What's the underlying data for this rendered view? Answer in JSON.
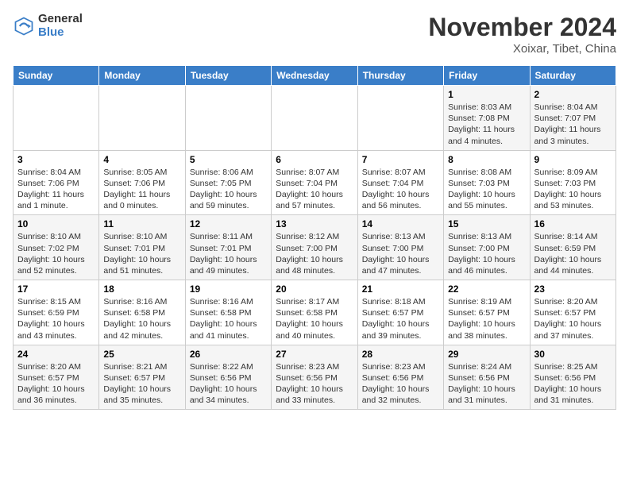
{
  "header": {
    "logo_line1": "General",
    "logo_line2": "Blue",
    "title": "November 2024",
    "subtitle": "Xoixar, Tibet, China"
  },
  "days_of_week": [
    "Sunday",
    "Monday",
    "Tuesday",
    "Wednesday",
    "Thursday",
    "Friday",
    "Saturday"
  ],
  "weeks": [
    [
      {
        "day": "",
        "info": ""
      },
      {
        "day": "",
        "info": ""
      },
      {
        "day": "",
        "info": ""
      },
      {
        "day": "",
        "info": ""
      },
      {
        "day": "",
        "info": ""
      },
      {
        "day": "1",
        "info": "Sunrise: 8:03 AM\nSunset: 7:08 PM\nDaylight: 11 hours and 4 minutes."
      },
      {
        "day": "2",
        "info": "Sunrise: 8:04 AM\nSunset: 7:07 PM\nDaylight: 11 hours and 3 minutes."
      }
    ],
    [
      {
        "day": "3",
        "info": "Sunrise: 8:04 AM\nSunset: 7:06 PM\nDaylight: 11 hours and 1 minute."
      },
      {
        "day": "4",
        "info": "Sunrise: 8:05 AM\nSunset: 7:06 PM\nDaylight: 11 hours and 0 minutes."
      },
      {
        "day": "5",
        "info": "Sunrise: 8:06 AM\nSunset: 7:05 PM\nDaylight: 10 hours and 59 minutes."
      },
      {
        "day": "6",
        "info": "Sunrise: 8:07 AM\nSunset: 7:04 PM\nDaylight: 10 hours and 57 minutes."
      },
      {
        "day": "7",
        "info": "Sunrise: 8:07 AM\nSunset: 7:04 PM\nDaylight: 10 hours and 56 minutes."
      },
      {
        "day": "8",
        "info": "Sunrise: 8:08 AM\nSunset: 7:03 PM\nDaylight: 10 hours and 55 minutes."
      },
      {
        "day": "9",
        "info": "Sunrise: 8:09 AM\nSunset: 7:03 PM\nDaylight: 10 hours and 53 minutes."
      }
    ],
    [
      {
        "day": "10",
        "info": "Sunrise: 8:10 AM\nSunset: 7:02 PM\nDaylight: 10 hours and 52 minutes."
      },
      {
        "day": "11",
        "info": "Sunrise: 8:10 AM\nSunset: 7:01 PM\nDaylight: 10 hours and 51 minutes."
      },
      {
        "day": "12",
        "info": "Sunrise: 8:11 AM\nSunset: 7:01 PM\nDaylight: 10 hours and 49 minutes."
      },
      {
        "day": "13",
        "info": "Sunrise: 8:12 AM\nSunset: 7:00 PM\nDaylight: 10 hours and 48 minutes."
      },
      {
        "day": "14",
        "info": "Sunrise: 8:13 AM\nSunset: 7:00 PM\nDaylight: 10 hours and 47 minutes."
      },
      {
        "day": "15",
        "info": "Sunrise: 8:13 AM\nSunset: 7:00 PM\nDaylight: 10 hours and 46 minutes."
      },
      {
        "day": "16",
        "info": "Sunrise: 8:14 AM\nSunset: 6:59 PM\nDaylight: 10 hours and 44 minutes."
      }
    ],
    [
      {
        "day": "17",
        "info": "Sunrise: 8:15 AM\nSunset: 6:59 PM\nDaylight: 10 hours and 43 minutes."
      },
      {
        "day": "18",
        "info": "Sunrise: 8:16 AM\nSunset: 6:58 PM\nDaylight: 10 hours and 42 minutes."
      },
      {
        "day": "19",
        "info": "Sunrise: 8:16 AM\nSunset: 6:58 PM\nDaylight: 10 hours and 41 minutes."
      },
      {
        "day": "20",
        "info": "Sunrise: 8:17 AM\nSunset: 6:58 PM\nDaylight: 10 hours and 40 minutes."
      },
      {
        "day": "21",
        "info": "Sunrise: 8:18 AM\nSunset: 6:57 PM\nDaylight: 10 hours and 39 minutes."
      },
      {
        "day": "22",
        "info": "Sunrise: 8:19 AM\nSunset: 6:57 PM\nDaylight: 10 hours and 38 minutes."
      },
      {
        "day": "23",
        "info": "Sunrise: 8:20 AM\nSunset: 6:57 PM\nDaylight: 10 hours and 37 minutes."
      }
    ],
    [
      {
        "day": "24",
        "info": "Sunrise: 8:20 AM\nSunset: 6:57 PM\nDaylight: 10 hours and 36 minutes."
      },
      {
        "day": "25",
        "info": "Sunrise: 8:21 AM\nSunset: 6:57 PM\nDaylight: 10 hours and 35 minutes."
      },
      {
        "day": "26",
        "info": "Sunrise: 8:22 AM\nSunset: 6:56 PM\nDaylight: 10 hours and 34 minutes."
      },
      {
        "day": "27",
        "info": "Sunrise: 8:23 AM\nSunset: 6:56 PM\nDaylight: 10 hours and 33 minutes."
      },
      {
        "day": "28",
        "info": "Sunrise: 8:23 AM\nSunset: 6:56 PM\nDaylight: 10 hours and 32 minutes."
      },
      {
        "day": "29",
        "info": "Sunrise: 8:24 AM\nSunset: 6:56 PM\nDaylight: 10 hours and 31 minutes."
      },
      {
        "day": "30",
        "info": "Sunrise: 8:25 AM\nSunset: 6:56 PM\nDaylight: 10 hours and 31 minutes."
      }
    ]
  ]
}
